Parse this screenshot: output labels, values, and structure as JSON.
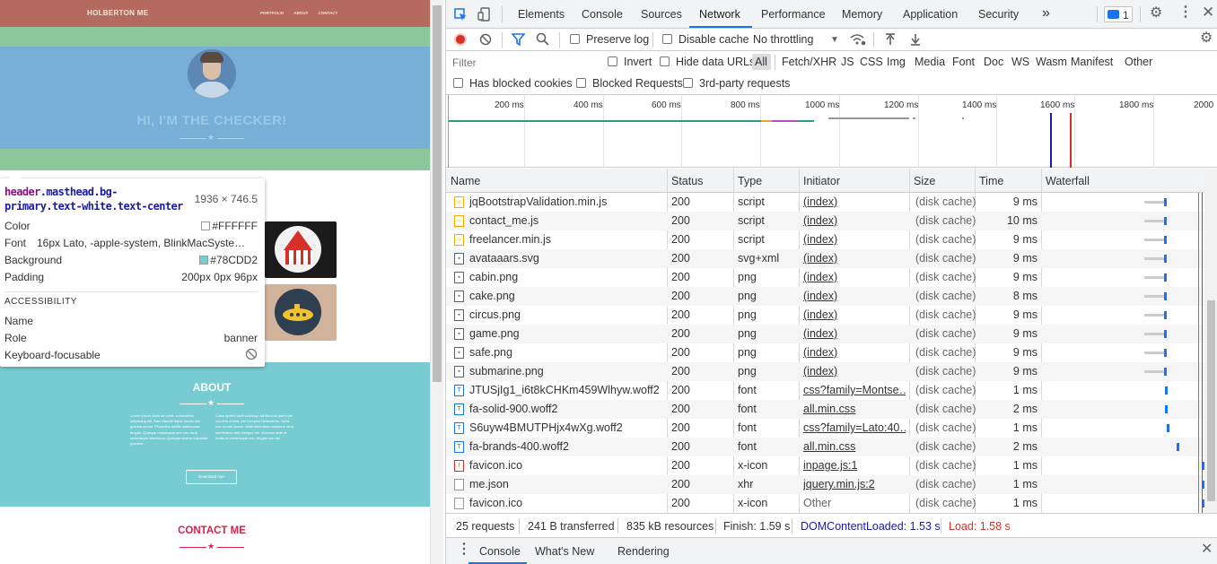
{
  "page": {
    "brand": "HOLBERTON ME",
    "nav_links": [
      "PORTFOLIO",
      "ABOUT",
      "CONTACT"
    ],
    "masthead_title": "HI, I'M THE CHECKER!",
    "about_title": "ABOUT",
    "about_text_left": "Lorem ipsum dolor sit amet, consectetur adipiscing elit. Nam blandit turpis iaculis nisl gravida auctor. Phasellus mattis malesuada feugiat. Quisque malesuada orci non risus scelerisque bibendum. Quisque viverra vulputate posuere.",
    "about_text_right": "Class aptent taciti sociosqu ad litora torquent per conubia nostra, per inceptos himenaeos. Nulla non ornare purus. Nulla bibendum maximus urna, sed finibus velit tristique vel. Vivamus ante et, mollis et scelerisque nec, feugiat non dui.",
    "download_label": "Download me!",
    "contact_title": "CONTACT ME",
    "colors": {
      "nav": "#b56a60",
      "masthead": "#78afd6",
      "about": "#77ccd2",
      "contact": "#d6204e"
    }
  },
  "tooltip": {
    "selector_tag": "header",
    "selector_classes": ".masthead.bg-primary.text-white.text-center",
    "dimensions": "1936 × 746.5",
    "rows": [
      {
        "key": "Color",
        "value": "#FFFFFF",
        "swatch": "#FFFFFF"
      },
      {
        "key": "Font",
        "value": "16px Lato, -apple-system, BlinkMacSyste…"
      },
      {
        "key": "Background",
        "value": "#78CDD2",
        "swatch": "#78CDD2"
      },
      {
        "key": "Padding",
        "value": "200px 0px 96px"
      }
    ],
    "accessibility_heading": "ACCESSIBILITY",
    "a11y_rows": [
      {
        "key": "Name",
        "value": ""
      },
      {
        "key": "Role",
        "value": "banner"
      },
      {
        "key": "Keyboard-focusable",
        "value": ""
      }
    ]
  },
  "devtools": {
    "tabs": [
      "Elements",
      "Console",
      "Sources",
      "Network",
      "Performance",
      "Memory",
      "Application",
      "Security"
    ],
    "active_tab": "Network",
    "more_tabs": "»",
    "issues_count": "1",
    "toolbar": {
      "preserve_log": "Preserve log",
      "disable_cache": "Disable cache",
      "throttling": "No throttling"
    },
    "filter": {
      "placeholder": "Filter",
      "invert": "Invert",
      "hide_data_urls": "Hide data URLs",
      "types": [
        "All",
        "Fetch/XHR",
        "JS",
        "CSS",
        "Img",
        "Media",
        "Font",
        "Doc",
        "WS",
        "Wasm",
        "Manifest",
        "Other"
      ],
      "has_blocked_cookies": "Has blocked cookies",
      "blocked_requests": "Blocked Requests",
      "third_party": "3rd-party requests"
    },
    "overview_ticks": [
      "200 ms",
      "400 ms",
      "600 ms",
      "800 ms",
      "1000 ms",
      "1200 ms",
      "1400 ms",
      "1600 ms",
      "1800 ms",
      "2000"
    ],
    "columns": [
      "Name",
      "Status",
      "Type",
      "Initiator",
      "Size",
      "Time",
      "Waterfall"
    ],
    "requests": [
      {
        "name": "jqBootstrapValidation.min.js",
        "status": "200",
        "type": "script",
        "initiator": "(index)",
        "size": "(disk cache)",
        "time": "9 ms",
        "icon": "js-file-icon"
      },
      {
        "name": "contact_me.js",
        "status": "200",
        "type": "script",
        "initiator": "(index)",
        "size": "(disk cache)",
        "time": "10 ms",
        "icon": "js-file-icon"
      },
      {
        "name": "freelancer.min.js",
        "status": "200",
        "type": "script",
        "initiator": "(index)",
        "size": "(disk cache)",
        "time": "9 ms",
        "icon": "js-file-icon"
      },
      {
        "name": "avataaars.svg",
        "status": "200",
        "type": "svg+xml",
        "initiator": "(index)",
        "size": "(disk cache)",
        "time": "9 ms",
        "icon": "image-file-icon"
      },
      {
        "name": "cabin.png",
        "status": "200",
        "type": "png",
        "initiator": "(index)",
        "size": "(disk cache)",
        "time": "9 ms",
        "icon": "image-file-icon"
      },
      {
        "name": "cake.png",
        "status": "200",
        "type": "png",
        "initiator": "(index)",
        "size": "(disk cache)",
        "time": "8 ms",
        "icon": "image-file-icon"
      },
      {
        "name": "circus.png",
        "status": "200",
        "type": "png",
        "initiator": "(index)",
        "size": "(disk cache)",
        "time": "9 ms",
        "icon": "image-file-icon"
      },
      {
        "name": "game.png",
        "status": "200",
        "type": "png",
        "initiator": "(index)",
        "size": "(disk cache)",
        "time": "9 ms",
        "icon": "image-file-icon"
      },
      {
        "name": "safe.png",
        "status": "200",
        "type": "png",
        "initiator": "(index)",
        "size": "(disk cache)",
        "time": "9 ms",
        "icon": "image-file-icon"
      },
      {
        "name": "submarine.png",
        "status": "200",
        "type": "png",
        "initiator": "(index)",
        "size": "(disk cache)",
        "time": "9 ms",
        "icon": "image-file-icon"
      },
      {
        "name": "JTUSjIg1_i6t8kCHKm459Wlhyw.woff2",
        "status": "200",
        "type": "font",
        "initiator": "css?family=Montse…",
        "size": "(disk cache)",
        "time": "1 ms",
        "icon": "font-file-icon"
      },
      {
        "name": "fa-solid-900.woff2",
        "status": "200",
        "type": "font",
        "initiator": "all.min.css",
        "size": "(disk cache)",
        "time": "2 ms",
        "icon": "font-file-icon"
      },
      {
        "name": "S6uyw4BMUTPHjx4wXg.woff2",
        "status": "200",
        "type": "font",
        "initiator": "css?family=Lato:40…",
        "size": "(disk cache)",
        "time": "1 ms",
        "icon": "font-file-icon"
      },
      {
        "name": "fa-brands-400.woff2",
        "status": "200",
        "type": "font",
        "initiator": "all.min.css",
        "size": "(disk cache)",
        "time": "2 ms",
        "icon": "font-file-icon"
      },
      {
        "name": "favicon.ico",
        "status": "200",
        "type": "x-icon",
        "initiator": "inpage.js:1",
        "size": "(disk cache)",
        "time": "1 ms",
        "icon": "ico-file-icon"
      },
      {
        "name": "me.json",
        "status": "200",
        "type": "xhr",
        "initiator": "jquery.min.js:2",
        "size": "(disk cache)",
        "time": "1 ms",
        "icon": "doc-file-icon"
      },
      {
        "name": "favicon.ico",
        "status": "200",
        "type": "x-icon",
        "initiator": "Other",
        "size": "(disk cache)",
        "time": "1 ms",
        "icon": "doc-file-icon"
      }
    ],
    "summary": {
      "requests": "25 requests",
      "transferred": "241 B transferred",
      "resources": "835 kB resources",
      "finish": "Finish: 1.59 s",
      "dom_content_loaded": "DOMContentLoaded: 1.53 s",
      "load": "Load: 1.58 s"
    },
    "drawer_tabs": [
      "Console",
      "What's New",
      "Rendering"
    ],
    "colors": {
      "accent": "#1a73e8",
      "dcl": "#1a1aa6",
      "load": "#d93025"
    }
  }
}
